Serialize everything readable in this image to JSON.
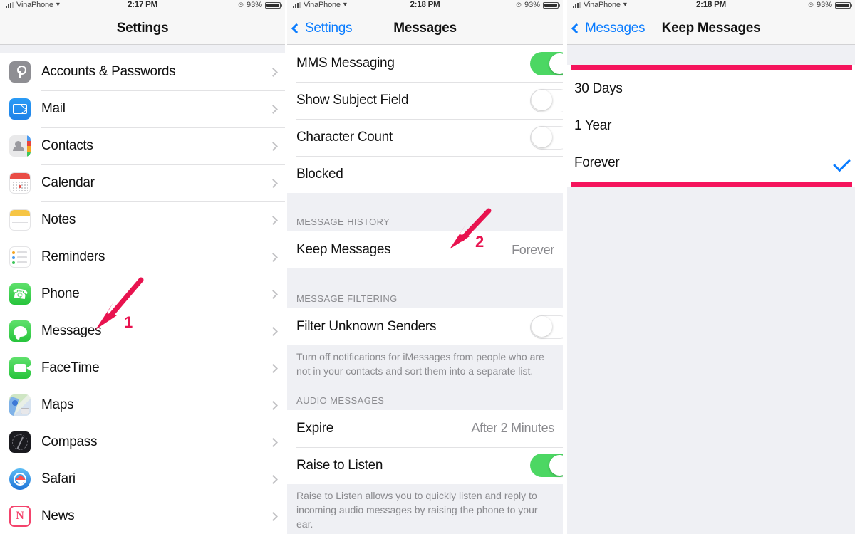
{
  "status_bar": {
    "carrier": "VinaPhone",
    "wifi_icon": "wifi-icon",
    "time_left": "2:17 PM",
    "time_mid": "2:18 PM",
    "time_right": "2:18 PM",
    "alarm_icon": "alarm-clock-icon",
    "battery_percent": "93%",
    "battery_icon": "battery-icon"
  },
  "left_panel": {
    "title": "Settings",
    "items": [
      {
        "label": "Accounts & Passwords",
        "icon": "key-icon"
      },
      {
        "label": "Mail",
        "icon": "envelope-icon"
      },
      {
        "label": "Contacts",
        "icon": "contacts-icon"
      },
      {
        "label": "Calendar",
        "icon": "calendar-icon"
      },
      {
        "label": "Notes",
        "icon": "notes-icon"
      },
      {
        "label": "Reminders",
        "icon": "reminders-icon"
      },
      {
        "label": "Phone",
        "icon": "phone-handset-icon"
      },
      {
        "label": "Messages",
        "icon": "message-bubble-icon"
      },
      {
        "label": "FaceTime",
        "icon": "video-camera-icon"
      },
      {
        "label": "Maps",
        "icon": "maps-icon"
      },
      {
        "label": "Compass",
        "icon": "compass-icon"
      },
      {
        "label": "Safari",
        "icon": "safari-compass-icon"
      },
      {
        "label": "News",
        "icon": "news-icon"
      }
    ]
  },
  "mid_panel": {
    "back_label": "Settings",
    "title": "Messages",
    "rows": [
      {
        "label": "MMS Messaging",
        "control": "toggle",
        "state": "on"
      },
      {
        "label": "Show Subject Field",
        "control": "toggle",
        "state": "off"
      },
      {
        "label": "Character Count",
        "control": "toggle",
        "state": "off"
      },
      {
        "label": "Blocked",
        "control": "disclosure"
      }
    ],
    "message_history": {
      "header": "MESSAGE HISTORY",
      "row_label": "Keep Messages",
      "row_value": "Forever"
    },
    "message_filtering": {
      "header": "MESSAGE FILTERING",
      "row_label": "Filter Unknown Senders",
      "state": "off",
      "note": "Turn off notifications for iMessages from people who are not in your contacts and sort them into a separate list."
    },
    "audio_messages": {
      "header": "AUDIO MESSAGES",
      "expire_label": "Expire",
      "expire_value": "After 2 Minutes",
      "raise_label": "Raise to Listen",
      "raise_state": "on",
      "note": "Raise to Listen allows you to quickly listen and reply to incoming audio messages by raising the phone to your ear."
    }
  },
  "right_panel": {
    "back_label": "Messages",
    "title": "Keep Messages",
    "options": [
      {
        "label": "30 Days",
        "selected": false
      },
      {
        "label": "1 Year",
        "selected": false
      },
      {
        "label": "Forever",
        "selected": true
      }
    ]
  },
  "annotations": {
    "accent_color": "#e8134f",
    "highlight_color": "#f5145c",
    "markers": [
      {
        "number": "1",
        "target": "sidebar-item-messages"
      },
      {
        "number": "2",
        "target": "keep-messages-row"
      }
    ]
  }
}
